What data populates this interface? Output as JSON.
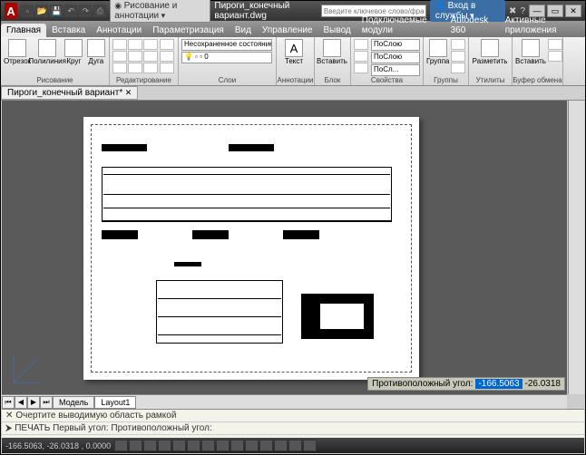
{
  "title": "Пироги_конечный вариант.dwg",
  "qat_annot": "Рисование и аннотации",
  "search_ph": "Введите ключевое слово/фразу",
  "login": "Вход в службы",
  "tabs": [
    "Главная",
    "Вставка",
    "Аннотации",
    "Параметризация",
    "Вид",
    "Управление",
    "Вывод",
    "Подключаемые модули",
    "Autodesk 360",
    "Активные приложения"
  ],
  "panels": {
    "draw": {
      "name": "Рисование",
      "b1": "Отрезок",
      "b2": "Полилиния",
      "b3": "Круг",
      "b4": "Дуга"
    },
    "mod": {
      "name": "Редактирование"
    },
    "layers": {
      "name": "Слои",
      "state": "Несохраненное состояние листа"
    },
    "annot": {
      "name": "Аннотации",
      "b": "Текст"
    },
    "block": {
      "name": "Блок",
      "b": "Вставить"
    },
    "props": {
      "name": "Свойства",
      "v1": "ПоСлою",
      "v2": "ПоСлою",
      "v3": "ПоСл..."
    },
    "groups": {
      "name": "Группы",
      "b": "Группа"
    },
    "utils": {
      "name": "Утилиты",
      "b": "Разметить"
    },
    "clip": {
      "name": "Буфер обмена",
      "b": "Вставить"
    }
  },
  "doctab": "Пироги_конечный вариант*",
  "prompt": {
    "label": "Противоположный угол:",
    "v1": "-166.5063",
    "v2": "-26.0318"
  },
  "layout": {
    "t1": "Модель",
    "t2": "Layout1"
  },
  "cmd": {
    "l1": "Очертите выводимую область рамкой",
    "l2": "ПЕЧАТЬ Первый угол: Противоположный угол:"
  },
  "coords": "-166.5063, -26.0318 , 0.0000"
}
